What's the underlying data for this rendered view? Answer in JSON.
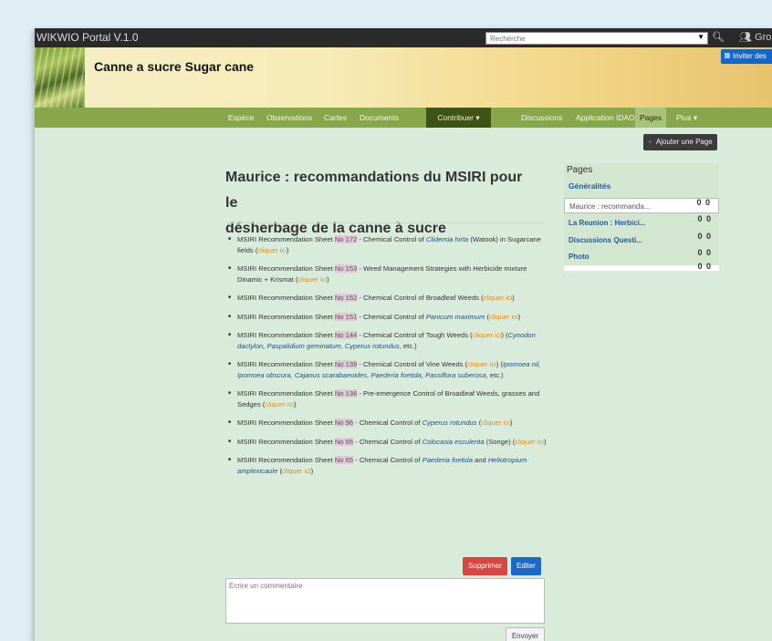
{
  "topbar": {
    "app_title": "WIKWIO Portal V.1.0",
    "search_placeholder": "Recherche",
    "groups_label": "Gro"
  },
  "banner": {
    "site_title": "Canne a sucre Sugar cane",
    "invite_label": "Inviter des"
  },
  "nav": {
    "items": [
      "Espèce",
      "Observations",
      "Cartes",
      "Documents"
    ],
    "contribute_label": "Contribuer",
    "right_items": [
      "Discussions",
      "Application IDAO"
    ],
    "pages_label": "Pages",
    "more_label": "Plus"
  },
  "toolbar": {
    "add_page_label": "Ajouter une Page"
  },
  "page": {
    "heading_line1": "Maurice : recommandations du MSIRI pour le",
    "heading_line2": "désherbage de la canne à sucre",
    "list_prefix": "MSIRI Recommendation Sheet",
    "click_label": "cliquer ici",
    "sheets": [
      {
        "no": "No 172",
        "a": " - Chemical Control of ",
        "sp": "Clidemia hirta",
        "b": " (Watook) in Sugarcane fields ("
      },
      {
        "no": "No 153",
        "a": " - Weed Management Strategies with Herbicide mixture Dinamic + Krismat ("
      },
      {
        "no": "No 152",
        "a": " - Chemical Control of Broadleaf Weeds ("
      },
      {
        "no": "No 151",
        "a": " - Chemical Control of ",
        "sp": "Panicum maximum",
        "b": " ("
      },
      {
        "no": "No 144",
        "a": " - Chemical Control of Tough Weeds (",
        "c": ") (",
        "sp2": "Cynodon dactylon, Paspalidium geminatum, Cyperus rotundus",
        "d": ", etc.)"
      },
      {
        "no": "No 139",
        "a": " - Chemical Control of Vine Weeds (",
        "c": ") (",
        "sp2": "Ipomoea nil, Ipomoea obscura, Cajanus scarabaeoides, Paederia foetida, Passiflora suberosa",
        "d": ", etc.)"
      },
      {
        "no": "No 136",
        "a": " - Pre-emergence Control of Broadleaf Weeds, grasses and Sedges ("
      },
      {
        "no": "No 96",
        "a": " - Chemical Control of ",
        "sp": "Cyperus rotundus",
        "b": " ("
      },
      {
        "no": "No 66",
        "a": " - Chemical Control of ",
        "sp": "Colocasia esculenta",
        "b": " (Songe) ("
      },
      {
        "no": "No 65",
        "a": " - Chemical Control of ",
        "sp": "Paederia foetida",
        "b": " and ",
        "sp3": "Heliotropium amplexicaule",
        "e": " ("
      }
    ],
    "close_paren": ")"
  },
  "sidebar": {
    "title": "Pages",
    "general_label": "Généralités",
    "items": [
      {
        "label": "Maurice : recommanda...",
        "marker": "0 0"
      },
      {
        "label": "La Reunion : Herbici...",
        "marker": "0 0"
      },
      {
        "label": "Discussions Questi...",
        "marker": "0 0"
      },
      {
        "label": "Photo",
        "marker": "0 0"
      }
    ],
    "bottom_marker": "0 0"
  },
  "actions": {
    "delete_label": "Supprimer",
    "edit_label": "Editer",
    "comment_placeholder": "Ecrire un commentaire",
    "send_label": "Envoyer"
  },
  "colors": {
    "nav_green": "#88a64a",
    "link_orange": "#e88a10",
    "delete_red": "#d9453f",
    "edit_blue": "#1b6ac9"
  }
}
